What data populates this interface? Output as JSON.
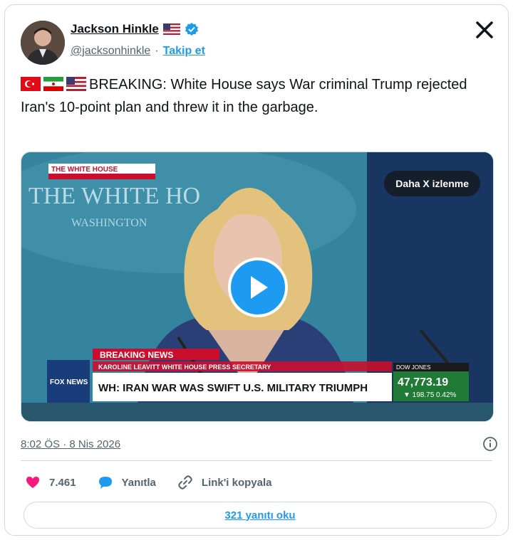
{
  "author": {
    "display_name": "Jackson Hinkle",
    "handle": "@jacksonhinkle",
    "separator": "·",
    "follow_label": "Takip et",
    "verified_icon": "verified-badge-icon",
    "flag_icon": "us-flag-icon"
  },
  "tweet": {
    "text": "BREAKING: White House says War criminal Trump rejected Iran's 10-point plan and threw it in the garbage.",
    "flags": [
      "turkey-flag-icon",
      "iran-flag-icon",
      "us-flag-icon"
    ]
  },
  "media": {
    "views_pill": "Daha X izlenme",
    "backdrop_text": "THE WHITE HO",
    "backdrop_subtext": "WASHINGTON",
    "corner_tag": "THE WHITE HOUSE",
    "breaking_label": "BREAKING NEWS",
    "lower_third_sub": "KAROLINE LEAVITT  WHITE HOUSE PRESS SECRETARY",
    "lower_third": "WH: IRAN WAR WAS SWIFT U.S. MILITARY TRIUMPH",
    "channel": "FOX NEWS",
    "ticker_label": "DOW JONES",
    "ticker_value": "47,773.19",
    "ticker_change": "▼ 198.75 0.42%"
  },
  "meta": {
    "timestamp": "8:02 ÖS · 8 Nis 2026"
  },
  "actions": {
    "like_count": "7.461",
    "reply_label": "Yanıtla",
    "copy_link_label": "Link'i kopyala"
  },
  "replies_button": "321 yanıtı oku",
  "colors": {
    "accent": "#1d9bf0",
    "like": "#f91880",
    "breaking_red": "#c8102e",
    "ticker_green": "#1e7a34"
  }
}
